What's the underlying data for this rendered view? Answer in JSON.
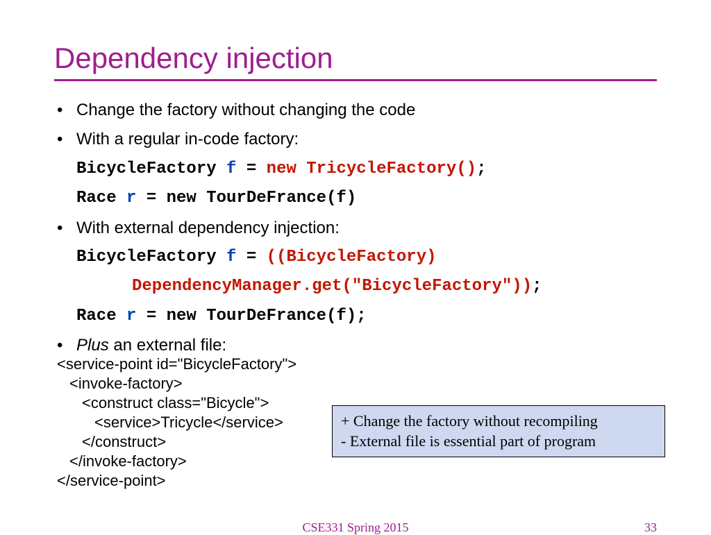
{
  "title": "Dependency injection",
  "bullets": {
    "b1": "Change the factory without changing the code",
    "b2": "With a regular in-code factory:",
    "b3": "With external dependency injection:"
  },
  "code1": {
    "t1": "BicycleFactory ",
    "t2": "f",
    "t3": " = ",
    "t4": "new TricycleFactory()",
    "t5": ";"
  },
  "code2": {
    "t1": "Race ",
    "t2": "r",
    "t3": " = new TourDeFrance(f)"
  },
  "code3": {
    "t1": "BicycleFactory ",
    "t2": "f",
    "t3": " = ",
    "t4": "((BicycleFactory)",
    "t5": "DependencyManager.get(\"BicycleFactory\"))",
    "t6": ";"
  },
  "code4": {
    "t1": "Race ",
    "t2": "r",
    "t3": " = new TourDeFrance(f);"
  },
  "bullet4": {
    "plus": "Plus",
    "rest": " an external file:"
  },
  "xml": {
    "l1": "<service-point id=\"BicycleFactory\">",
    "l2": "<invoke-factory>",
    "l3": "<construct class=\"Bicycle\">",
    "l4": "<service>Tricycle</service>",
    "l5": "</construct>",
    "l6": "</invoke-factory>",
    "l7": "</service-point>"
  },
  "callout": {
    "l1": "+ Change the factory without recompiling",
    "l2": "-  External file is essential part of program"
  },
  "footer": {
    "center": "CSE331 Spring 2015",
    "page": "33"
  }
}
